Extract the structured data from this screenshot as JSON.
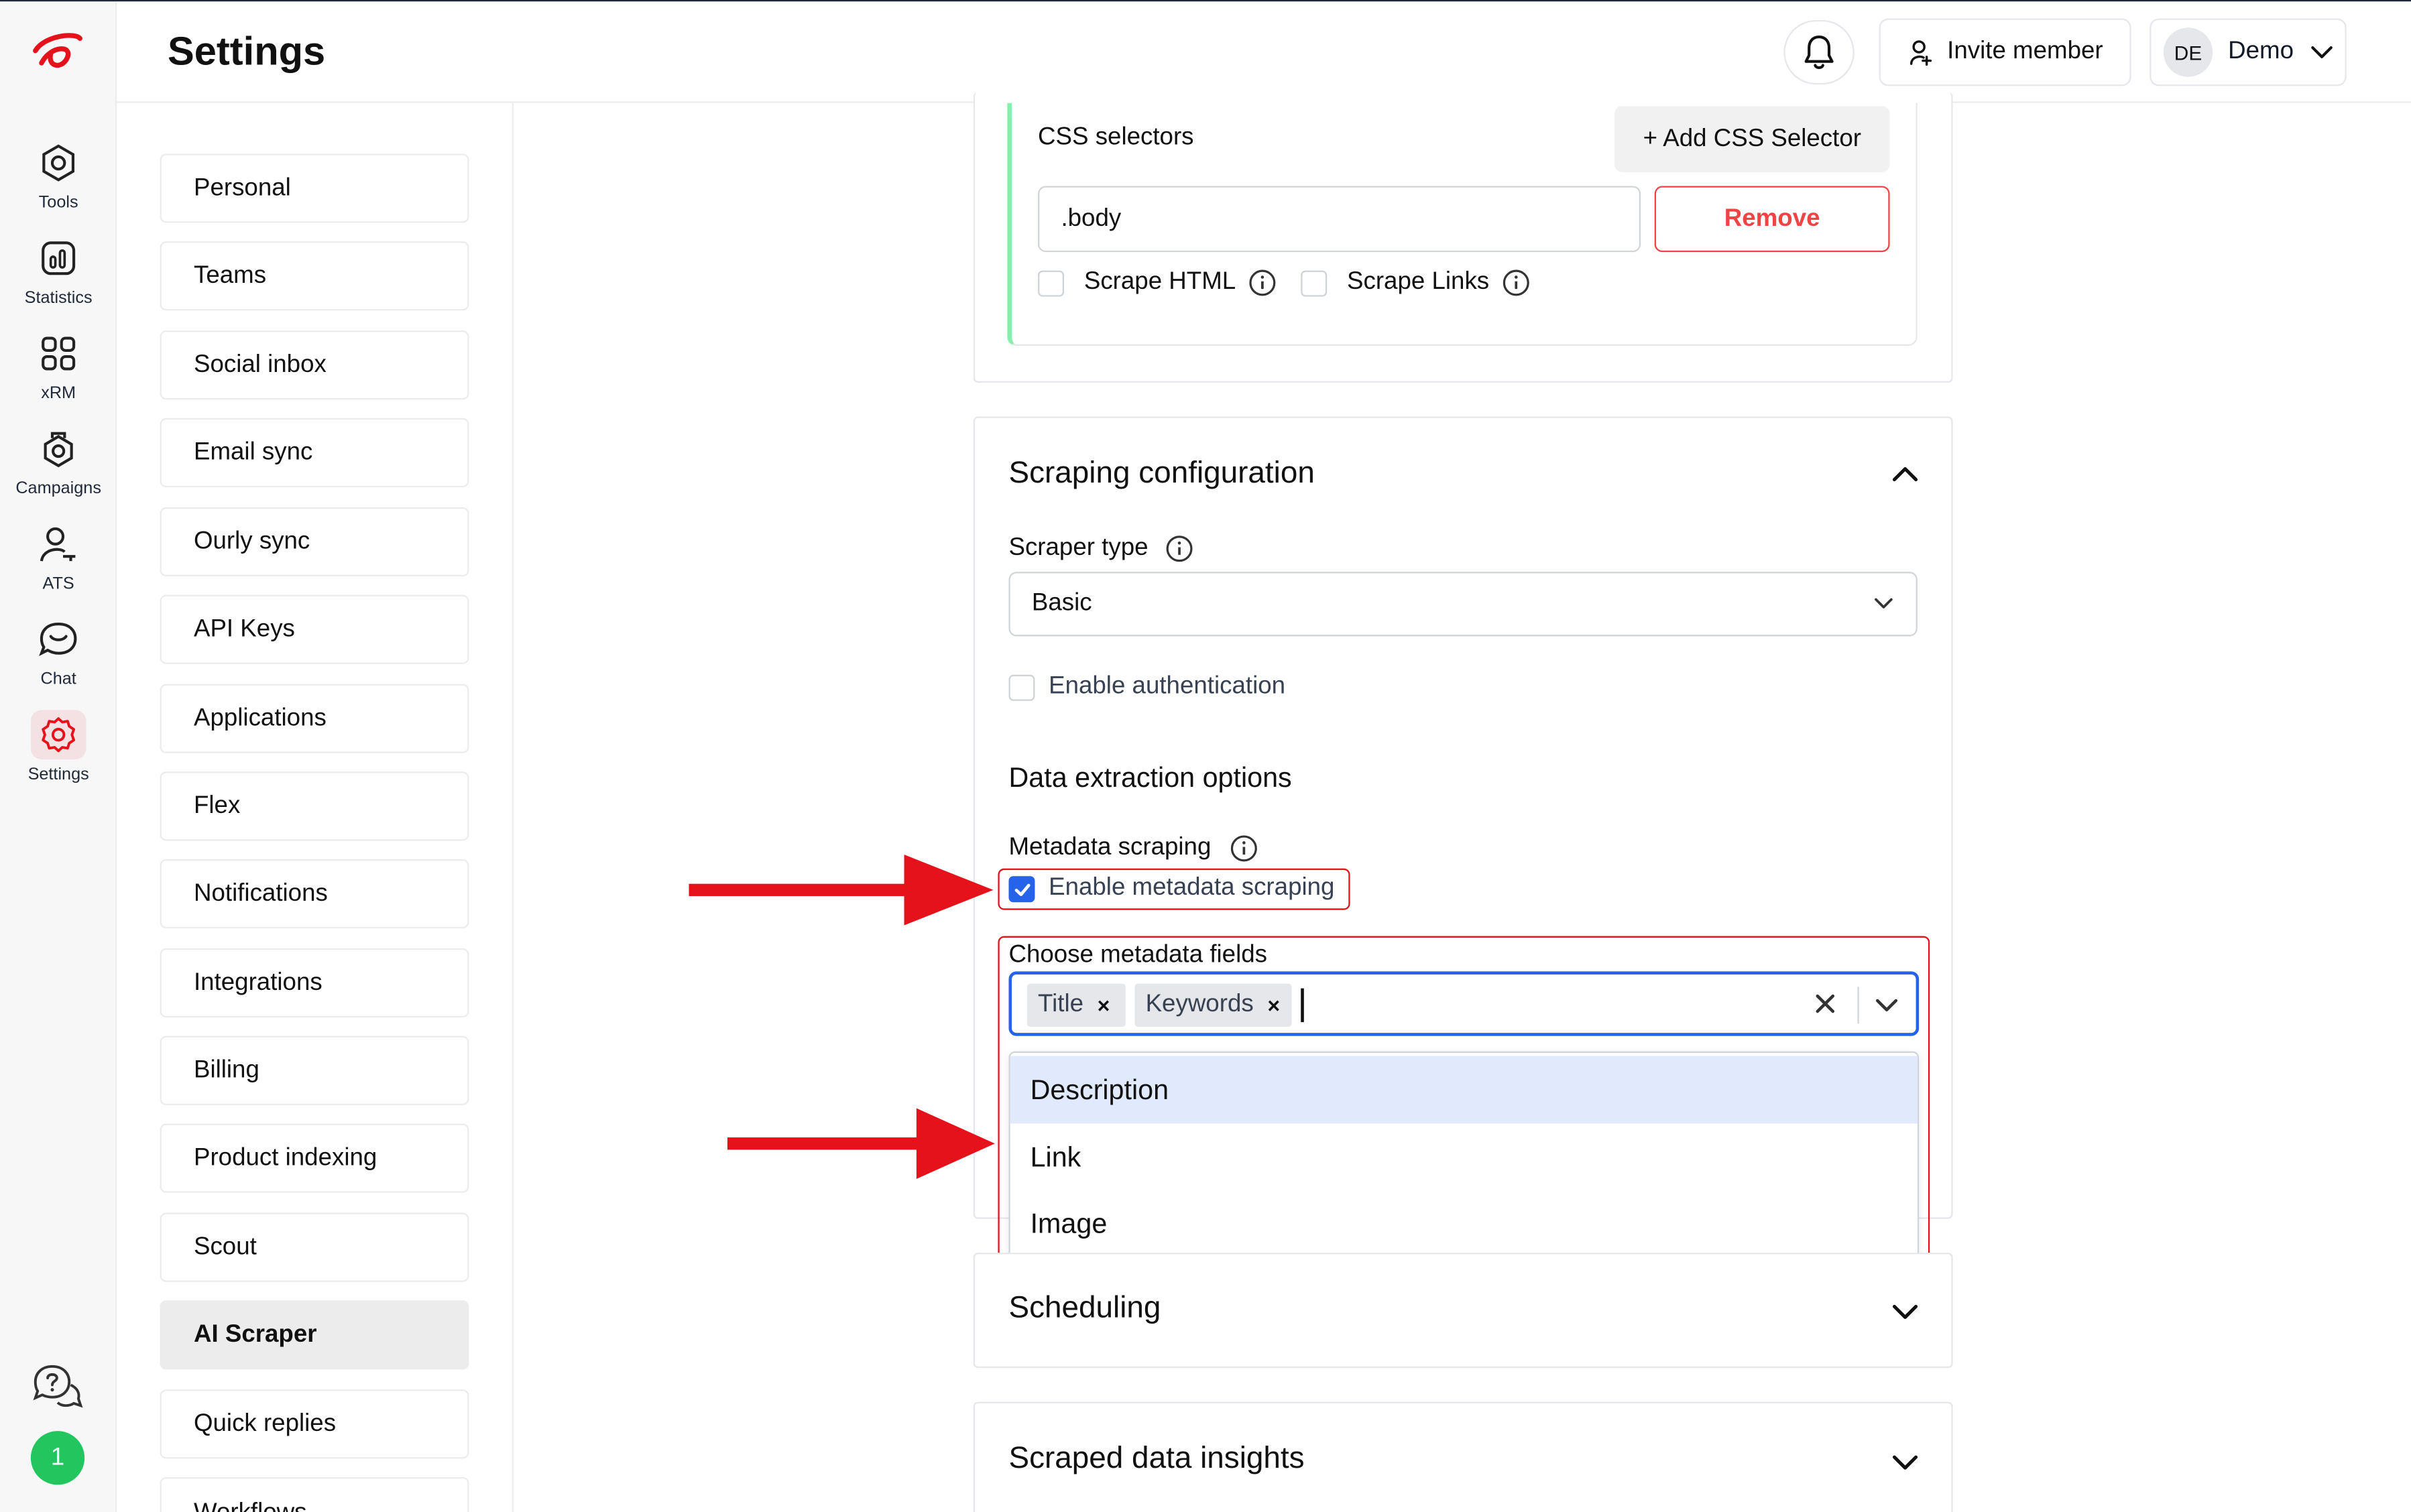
{
  "header": {
    "title": "Settings",
    "invite_label": "Invite member",
    "user_initials": "DE",
    "user_name": "Demo"
  },
  "rail": {
    "items": [
      {
        "label": "Tools",
        "icon": "hexagon-tools-icon"
      },
      {
        "label": "Statistics",
        "icon": "bar-chart-icon"
      },
      {
        "label": "xRM",
        "icon": "grid-icon"
      },
      {
        "label": "Campaigns",
        "icon": "campaigns-icon"
      },
      {
        "label": "ATS",
        "icon": "user-key-icon"
      },
      {
        "label": "Chat",
        "icon": "chat-icon"
      },
      {
        "label": "Settings",
        "icon": "gear-icon"
      }
    ],
    "notification_count": "1",
    "active_color": "#e5121b"
  },
  "nav": {
    "items": [
      "Personal",
      "Teams",
      "Social inbox",
      "Email sync",
      "Ourly sync",
      "API Keys",
      "Applications",
      "Flex",
      "Notifications",
      "Integrations",
      "Billing",
      "Product indexing",
      "Scout",
      "AI Scraper",
      "Quick replies",
      "Workflows"
    ],
    "active": "AI Scraper"
  },
  "css_selectors": {
    "title": "CSS selectors",
    "add_label": "+ Add CSS Selector",
    "value": ".body",
    "remove_label": "Remove",
    "scrape_html_label": "Scrape HTML",
    "scrape_links_label": "Scrape Links"
  },
  "scraping": {
    "title": "Scraping configuration",
    "scraper_type_label": "Scraper type",
    "scraper_type_value": "Basic",
    "auth_label": "Enable authentication",
    "extraction_title": "Data extraction options",
    "metadata_label": "Metadata scraping",
    "metadata_enable_label": "Enable metadata scraping",
    "metadata_enabled": true,
    "fields_label": "Choose metadata fields",
    "selected_fields": [
      "Title",
      "Keywords"
    ],
    "options": [
      "Description",
      "Link",
      "Image"
    ],
    "highlighted_option": "Description"
  },
  "sections": {
    "scheduling": "Scheduling",
    "insights": "Scraped data insights"
  },
  "colors": {
    "accent_blue": "#2563eb",
    "annotation_red": "#e5121b",
    "remove_red": "#ef4444"
  }
}
